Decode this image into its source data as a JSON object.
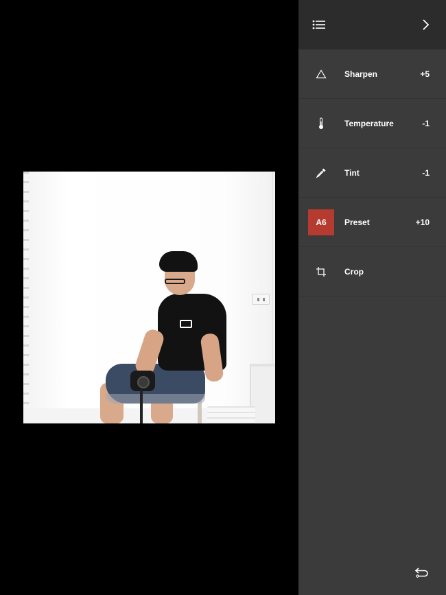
{
  "header": {
    "menu_icon": "list-icon",
    "next_icon": "chevron-right-icon"
  },
  "tools": [
    {
      "icon": "triangle-icon",
      "label": "Sharpen",
      "value": "+5"
    },
    {
      "icon": "thermometer-icon",
      "label": "Temperature",
      "value": "-1"
    },
    {
      "icon": "dropper-icon",
      "label": "Tint",
      "value": "-1"
    },
    {
      "icon": "preset-badge",
      "badge": "A6",
      "label": "Preset",
      "value": "+10"
    },
    {
      "icon": "crop-icon",
      "label": "Crop",
      "value": ""
    }
  ],
  "footer": {
    "undo_icon": "undo-icon"
  },
  "colors": {
    "panel_bg": "#3b3b3b",
    "header_bg": "#2c2c2c",
    "preset_badge": "#b53a2f",
    "canvas_bg": "#000000"
  }
}
